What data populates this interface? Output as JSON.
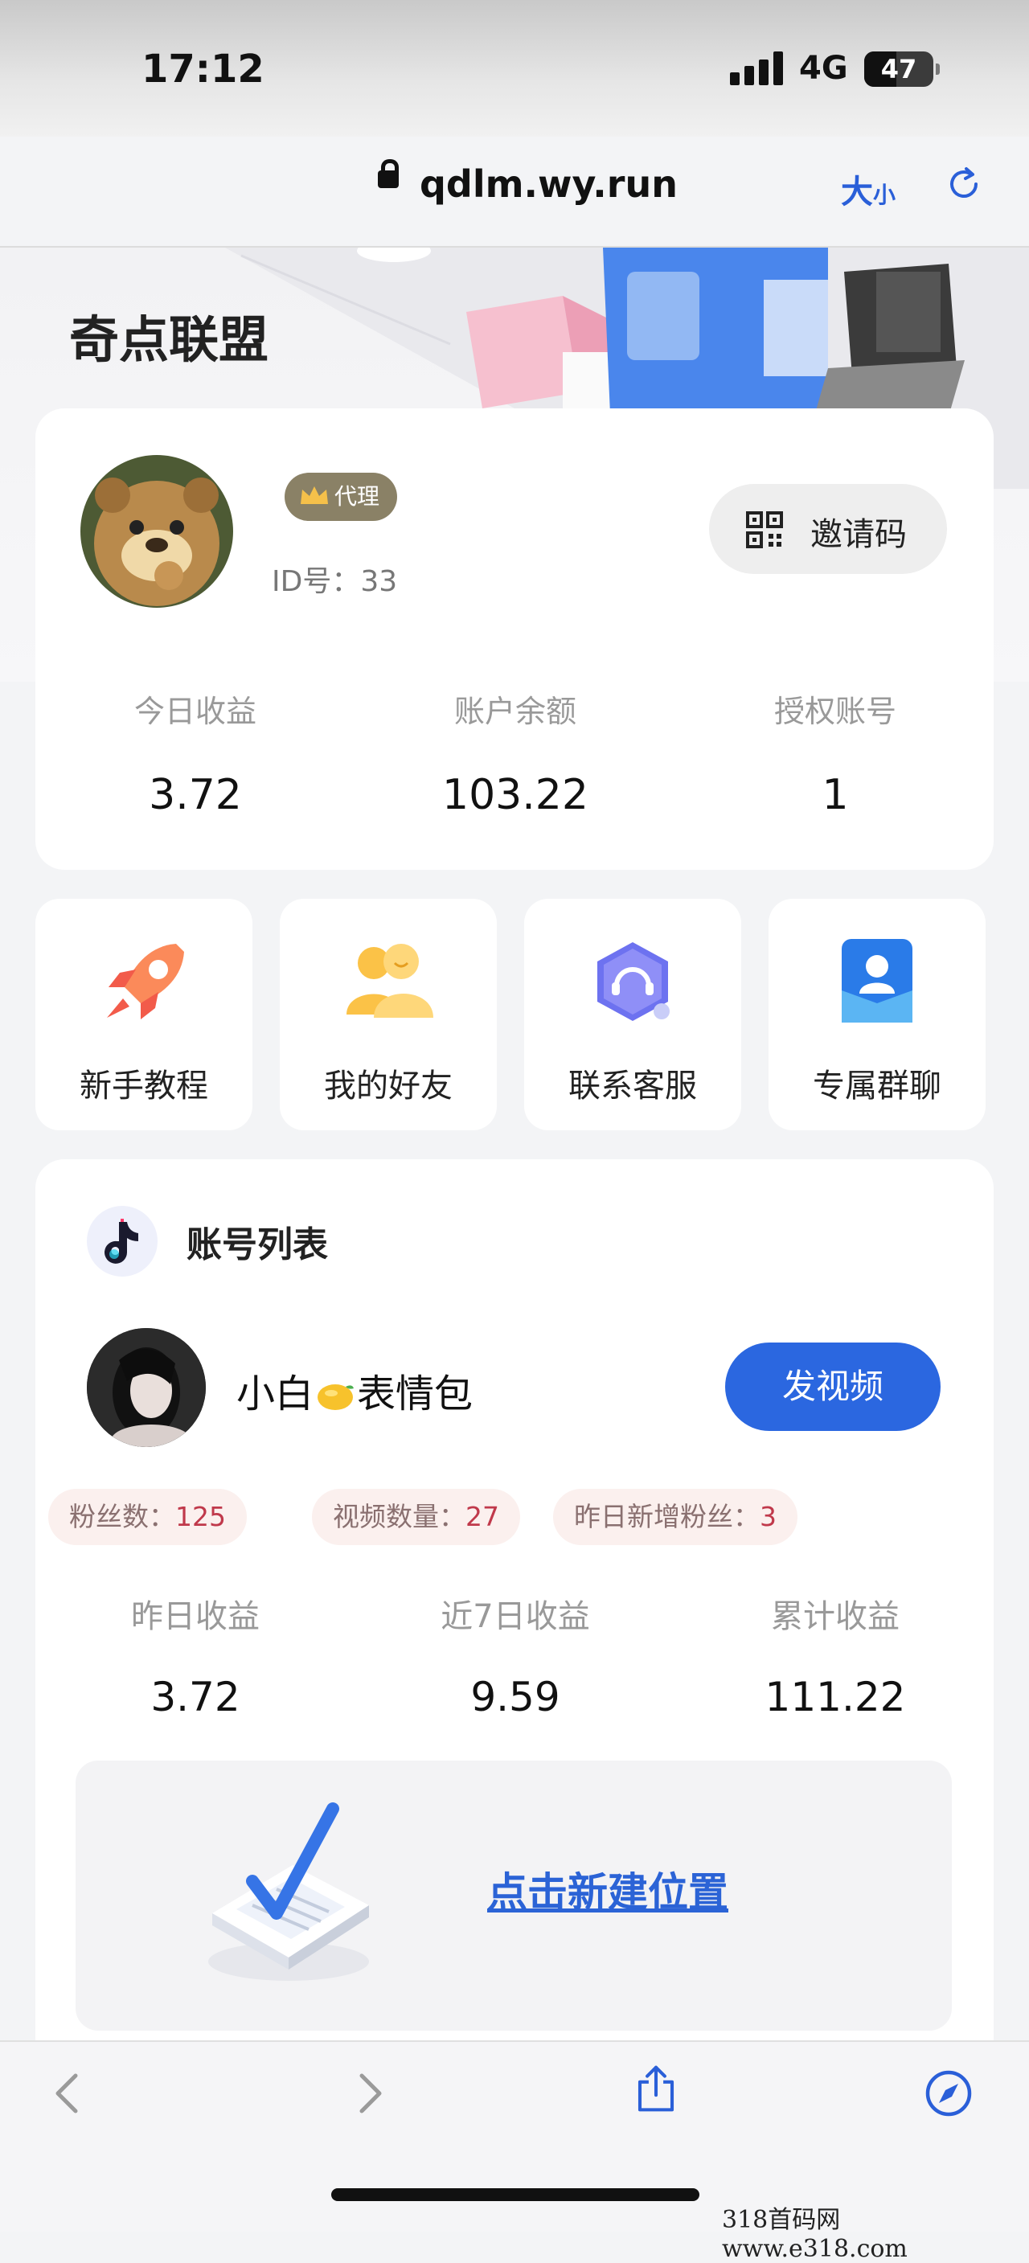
{
  "status_bar": {
    "time": "17:12",
    "network": "4G",
    "battery": "47",
    "battery_level_percent": 47
  },
  "browser": {
    "url": "qdlm.wy.run",
    "text_size_big": "大",
    "text_size_small": "小"
  },
  "app": {
    "title": "奇点联盟"
  },
  "profile": {
    "badge": "代理",
    "id_text": "ID号：33",
    "invite_label": "邀请码",
    "stats": [
      {
        "label": "今日收益",
        "value": "3.72"
      },
      {
        "label": "账户余额",
        "value": "103.22"
      },
      {
        "label": "授权账号",
        "value": "1"
      }
    ]
  },
  "quick_actions": [
    {
      "label": "新手教程",
      "icon": "rocket-icon"
    },
    {
      "label": "我的好友",
      "icon": "friends-icon"
    },
    {
      "label": "联系客服",
      "icon": "customer-service-icon"
    },
    {
      "label": "专属群聊",
      "icon": "group-chat-icon"
    }
  ],
  "accounts": {
    "section_title": "账号列表",
    "user": {
      "name_part1": "小白",
      "name_emoji": "lemon-emoji",
      "name_part2": "表情包",
      "post_button": "发视频"
    },
    "tags": [
      {
        "label": "粉丝数：",
        "value": "125"
      },
      {
        "label": "视频数量：",
        "value": "27"
      },
      {
        "label": "昨日新增粉丝：",
        "value": "3"
      }
    ],
    "stats": [
      {
        "label": "昨日收益",
        "value": "3.72"
      },
      {
        "label": "近7日收益",
        "value": "9.59"
      },
      {
        "label": "累计收益",
        "value": "111.22"
      }
    ],
    "new_position_link": "点击新建位置"
  },
  "watermark": "318首码网 www.e318.com",
  "colors": {
    "accent": "#2b67e0",
    "link": "#2b63d6",
    "tag_value": "#c0394b",
    "badge": "#8a8166"
  }
}
